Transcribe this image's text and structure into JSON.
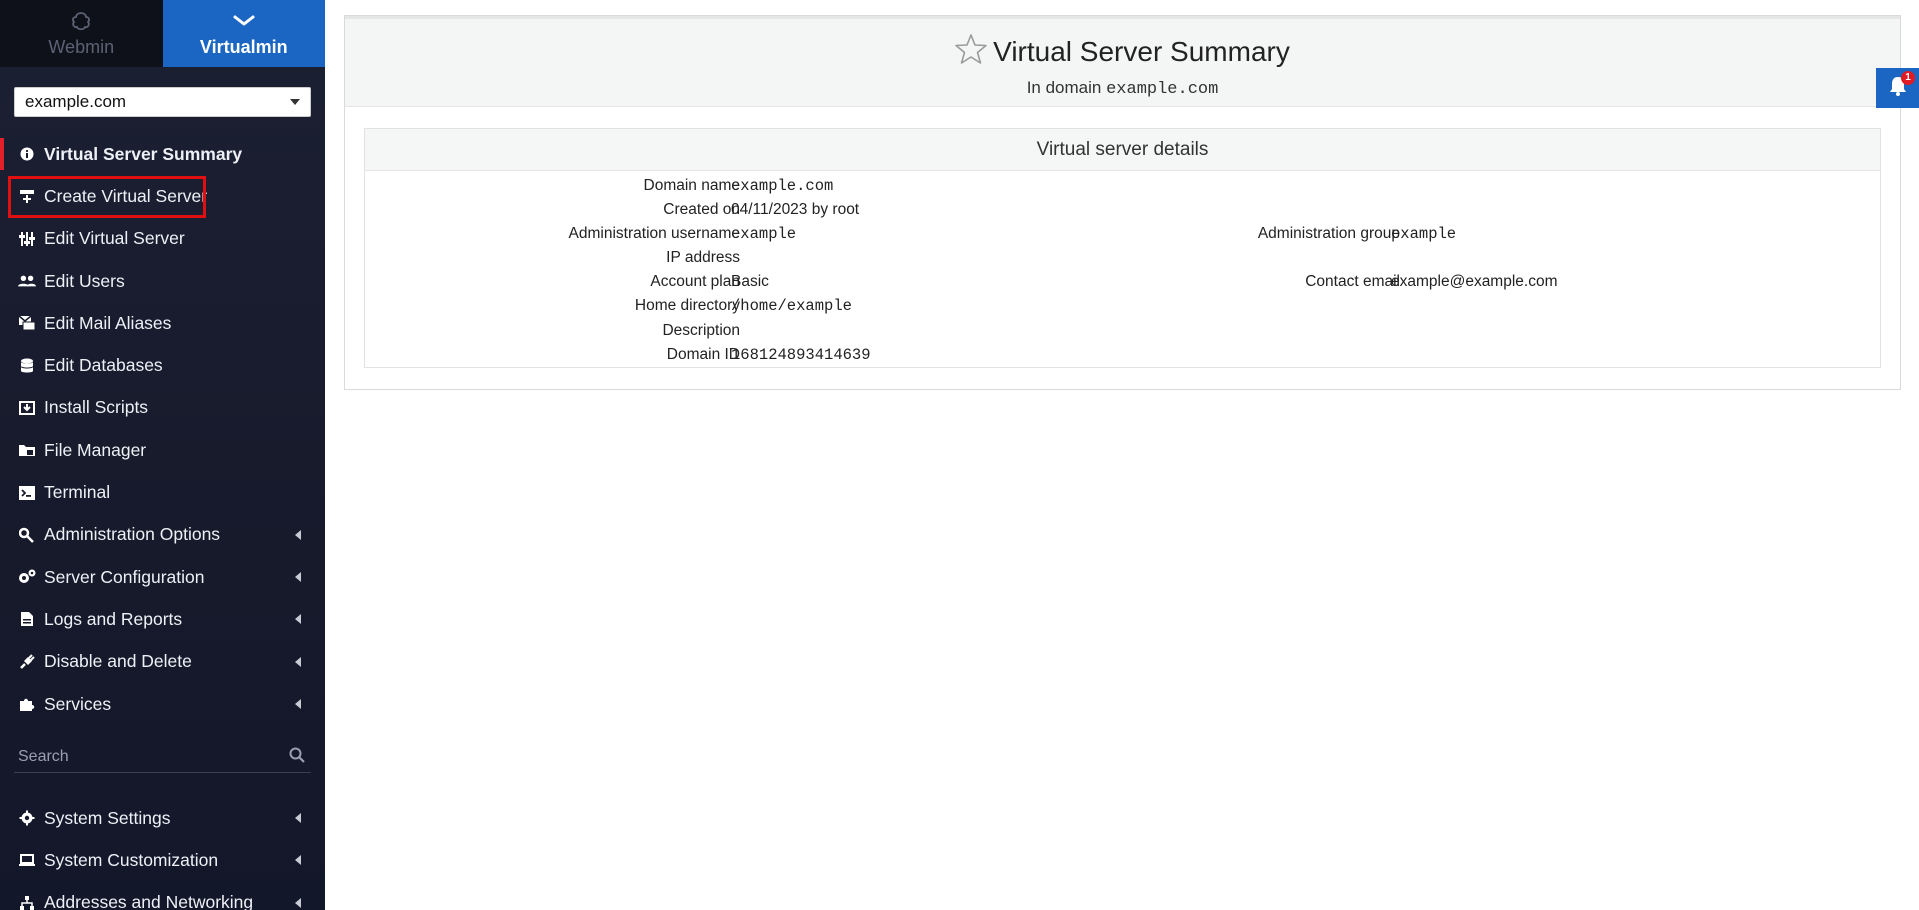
{
  "sidebar": {
    "tabs": [
      {
        "label": "Webmin",
        "icon": "webmin-logo-icon"
      },
      {
        "label": "Virtualmin",
        "icon": "chevron-down-icon"
      }
    ],
    "domain_select": "example.com",
    "items": [
      {
        "label": "Virtual Server Summary",
        "icon": "info-circle-icon"
      },
      {
        "label": "Create Virtual Server",
        "icon": "create-server-icon"
      },
      {
        "label": "Edit Virtual Server",
        "icon": "sliders-icon"
      },
      {
        "label": "Edit Users",
        "icon": "users-icon"
      },
      {
        "label": "Edit Mail Aliases",
        "icon": "mail-aliases-icon"
      },
      {
        "label": "Edit Databases",
        "icon": "database-icon"
      },
      {
        "label": "Install Scripts",
        "icon": "install-scripts-icon"
      },
      {
        "label": "File Manager",
        "icon": "folder-icon"
      },
      {
        "label": "Terminal",
        "icon": "terminal-icon"
      },
      {
        "label": "Administration Options",
        "icon": "key-icon"
      },
      {
        "label": "Server Configuration",
        "icon": "gears-icon"
      },
      {
        "label": "Logs and Reports",
        "icon": "file-icon"
      },
      {
        "label": "Disable and Delete",
        "icon": "plug-icon"
      },
      {
        "label": "Services",
        "icon": "puzzle-icon"
      }
    ],
    "search_placeholder": "Search",
    "bottom_items": [
      {
        "label": "System Settings",
        "icon": "gear-icon"
      },
      {
        "label": "System Customization",
        "icon": "laptop-icon"
      },
      {
        "label": "Addresses and Networking",
        "icon": "network-icon"
      }
    ]
  },
  "header": {
    "title": "Virtual Server Summary",
    "subtitle_prefix": "In domain",
    "subtitle_domain": "example.com"
  },
  "notifications": {
    "count": "1"
  },
  "details": {
    "heading": "Virtual server details",
    "domain_name": {
      "label": "Domain name",
      "value": "example.com"
    },
    "created_on": {
      "label": "Created on",
      "value": "04/11/2023 by root"
    },
    "admin_username": {
      "label": "Administration username",
      "value": "example"
    },
    "admin_group": {
      "label": "Administration group",
      "value": "example"
    },
    "ip_address": {
      "label": "IP address",
      "value": ""
    },
    "account_plan": {
      "label": "Account plan",
      "value": "Basic"
    },
    "contact_email": {
      "label": "Contact email",
      "value": "example@example.com"
    },
    "home_directory": {
      "label": "Home directory",
      "value": "/home/example"
    },
    "description": {
      "label": "Description",
      "value": ""
    },
    "domain_id": {
      "label": "Domain ID",
      "value": "168124893414639"
    }
  },
  "colors": {
    "accent": "#1a66c2",
    "sidebar_bg": "#161a2b",
    "active_marker": "#e0202a",
    "highlight_box": "#e01010"
  }
}
